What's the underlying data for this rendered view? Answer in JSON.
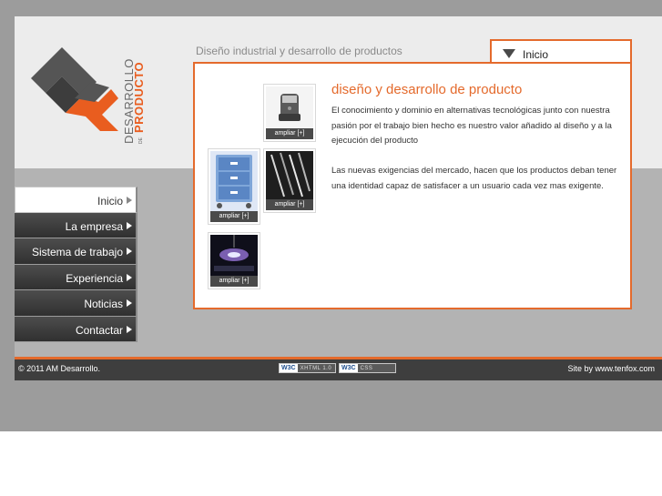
{
  "header": {
    "logo_top": "DESARROLLO",
    "logo_small": "DE",
    "logo_bottom": "PRODUCTO",
    "tagline": "Diseño industrial y desarrollo de productos"
  },
  "tab": {
    "label": "Inicio"
  },
  "content": {
    "title": "diseño y desarrollo de producto",
    "paragraph1": "El conocimiento y dominio en alternativas  tecnológicas junto con nuestra pasión por el trabajo bien hecho es nuestro valor añadido al diseño y a la ejecución del producto",
    "paragraph2": "Las nuevas exigencias del mercado, hacen que los productos deban tener una identidad capaz de satisfacer a un usuario cada vez mas exigente."
  },
  "thumbnails": [
    {
      "label": "ampliar [+]"
    },
    {
      "label": "ampliar [+]"
    },
    {
      "label": "ampliar [+]"
    },
    {
      "label": "ampliar [+]"
    }
  ],
  "nav": {
    "items": [
      {
        "label": "Inicio",
        "active": true
      },
      {
        "label": "La empresa"
      },
      {
        "label": "Sistema de trabajo"
      },
      {
        "label": "Experiencia"
      },
      {
        "label": "Noticias"
      },
      {
        "label": "Contactar"
      }
    ]
  },
  "footer": {
    "copyright": "© 2011 AM Desarrollo.",
    "badge1_w3c": "W3C",
    "badge1_text": "XHTML 1.0",
    "badge2_w3c": "W3C",
    "badge2_text": "CSS",
    "site_by": "Site by www.tenfox.com"
  },
  "colors": {
    "accent": "#e46a2c",
    "dark": "#3e3e3e",
    "gray": "#9c9c9c"
  }
}
